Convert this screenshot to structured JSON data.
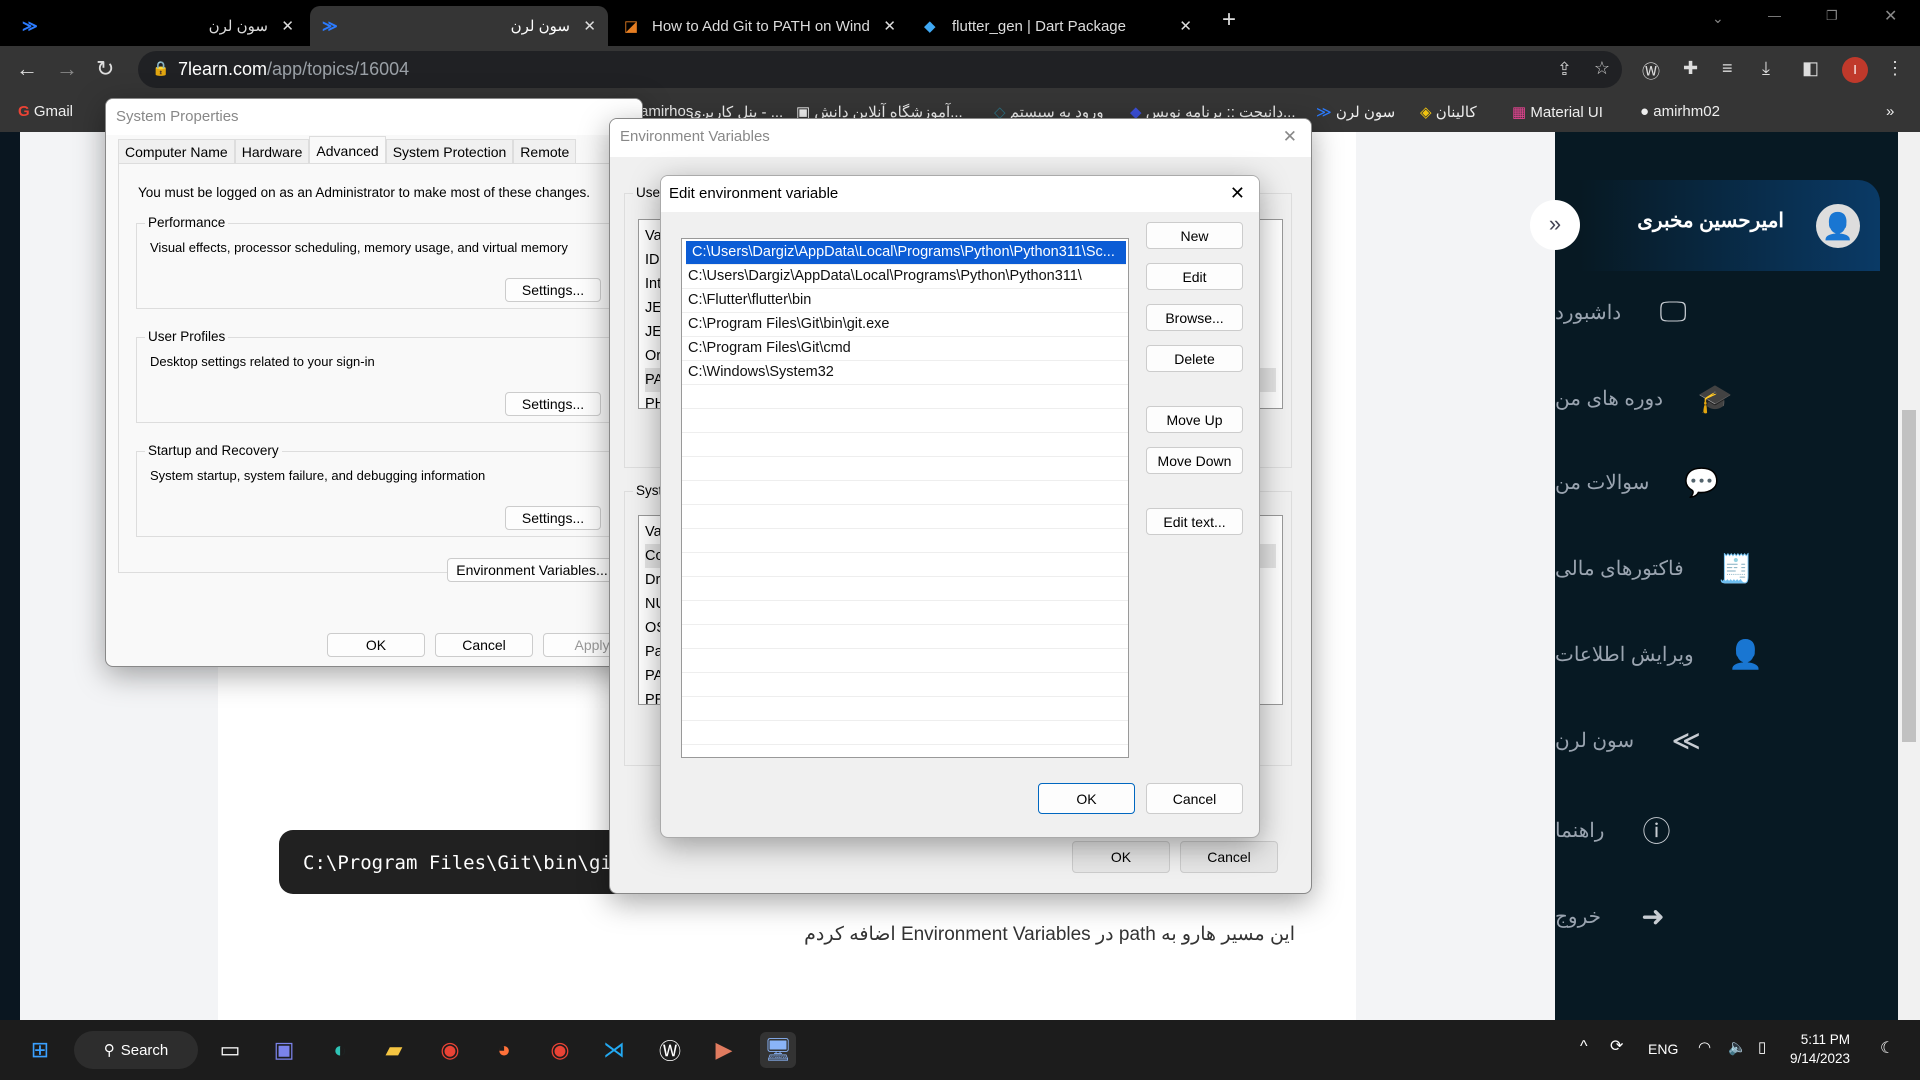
{
  "browser": {
    "tabs": [
      {
        "label": "سون لرن",
        "icon": "7learn-logo"
      },
      {
        "label": "سون لرن",
        "icon": "7learn-logo",
        "active": true
      },
      {
        "label": "How to Add Git to PATH on Wind",
        "icon": "article-icon"
      },
      {
        "label": "flutter_gen | Dart Package",
        "icon": "dart-logo"
      }
    ],
    "close_glyph": "✕",
    "new_tab": "+",
    "url_host": "7learn.com",
    "url_path": "/app/topics/16004",
    "profile_initial": "I",
    "profile_color": "#c0392b",
    "bookmarks": [
      "Gmail",
      "amirhm02",
      "Material UI",
      "کالینان",
      "سون لرن",
      "دانیجت :: برنامه نویس...",
      "ورود به سیستم",
      "آموزشگاه آنلاین دانش...",
      "پنل کاربری - ...",
      "amirhos..."
    ],
    "more": "»"
  },
  "page": {
    "code": "C:\\Program Files\\Git\\bin\\git",
    "text": "این مسیر هارو به path در Environment Variables اضافه کردم"
  },
  "sidebar": {
    "user": "امیرحسین مخبری",
    "collapse": "»",
    "items": [
      {
        "label": "داشبورد",
        "icon": "monitor-icon"
      },
      {
        "label": "دوره های من",
        "icon": "graduation-cap-icon"
      },
      {
        "label": "سوالات من",
        "icon": "chat-icon"
      },
      {
        "label": "فاکتورهای مالی",
        "icon": "receipt-icon"
      },
      {
        "label": "ویرایش اطلاعات",
        "icon": "user-edit-icon"
      },
      {
        "label": "سون لرن",
        "icon": "7learn-logo"
      },
      {
        "label": "راهنما",
        "icon": "info-icon"
      },
      {
        "label": "خروج",
        "icon": "logout-icon"
      }
    ]
  },
  "sysprops": {
    "title": "System Properties",
    "tabs": [
      "Computer Name",
      "Hardware",
      "Advanced",
      "System Protection",
      "Remote"
    ],
    "notice": "You must be logged on as an Administrator to make most of these changes.",
    "groups": [
      {
        "title": "Performance",
        "desc": "Visual effects, processor scheduling, memory usage, and virtual memory",
        "button": "Settings..."
      },
      {
        "title": "User Profiles",
        "desc": "Desktop settings related to your sign-in",
        "button": "Settings..."
      },
      {
        "title": "Startup and Recovery",
        "desc": "System startup, system failure, and debugging information",
        "button": "Settings..."
      }
    ],
    "env_button": "Environment Variables...",
    "ok": "OK",
    "cancel": "Cancel",
    "apply": "Apply"
  },
  "envvars": {
    "title": "Environment Variables",
    "user_label": "User",
    "system_label": "Syste",
    "user_rows": [
      "Va",
      "ID",
      "Int",
      "JE",
      "JE",
      "Or",
      "PA",
      "PH"
    ],
    "system_rows": [
      "Va",
      "Co",
      "Dr",
      "NU",
      "OS",
      "Pa",
      "PA",
      "PR"
    ],
    "ok": "OK",
    "cancel": "Cancel"
  },
  "editvar": {
    "title": "Edit environment variable",
    "entries": [
      "C:\\Users\\Dargiz\\AppData\\Local\\Programs\\Python\\Python311\\Sc...",
      "C:\\Users\\Dargiz\\AppData\\Local\\Programs\\Python\\Python311\\",
      "C:\\Flutter\\flutter\\bin",
      "C:\\Program Files\\Git\\bin\\git.exe",
      "C:\\Program Files\\Git\\cmd",
      "C:\\Windows\\System32"
    ],
    "buttons": [
      "New",
      "Edit",
      "Browse...",
      "Delete",
      "Move Up",
      "Move Down",
      "Edit text..."
    ],
    "ok": "OK",
    "cancel": "Cancel"
  },
  "taskbar": {
    "search": "Search",
    "lang": "ENG",
    "time": "5:11 PM",
    "date": "9/14/2023"
  }
}
